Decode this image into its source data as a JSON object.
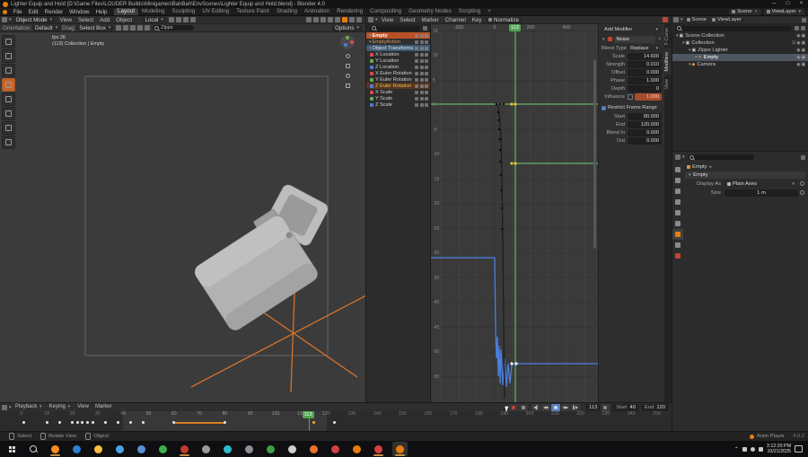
{
  "colors": {
    "accent": "#e87d0d",
    "playhead": "#53a553",
    "hold_bar": "#d87c20",
    "curve_blue": "#4a7fe0",
    "curve_green": "#69b36a"
  },
  "titlebar": {
    "title": "Lighter Equip and Hold [D:\\Game Files\\LOUDER Builds\\Minigames\\BahBah\\EnvScenes\\Lighter Equip and Hold.blend] - Blender 4.0",
    "controls": [
      "minimize",
      "maximize",
      "close"
    ]
  },
  "topbar": {
    "menus": [
      "File",
      "Edit",
      "Render",
      "Window",
      "Help"
    ],
    "tabs": [
      "Layout",
      "Modeling",
      "Sculpting",
      "UV Editing",
      "Texture Paint",
      "Shading",
      "Animation",
      "Rendering",
      "Compositing",
      "Geometry Nodes",
      "Scripting",
      "+"
    ],
    "active_tab": "Layout",
    "scene": "Scene",
    "view_layer": "ViewLayer"
  },
  "viewport": {
    "mode": "Object Mode",
    "menus": [
      "View",
      "Select",
      "Add",
      "Object"
    ],
    "transform_pivot": "Local",
    "header_icons": [
      "visibility-dropdown-icon",
      "gizmo-toggle-icon",
      "overlays-toggle-icon",
      "xray-toggle-icon",
      "wireframe-shading-icon",
      "solid-shading-icon",
      "material-shading-icon",
      "rendered-shading-icon"
    ],
    "active_shading_index": 5,
    "mid_icons": [
      "snap-magnet-icon",
      "snap-target-icon",
      "proportional-edit-icon",
      "proportional-falloff-icon"
    ],
    "tool_settings": {
      "orientation_label": "Orientation:",
      "orientation": "Default",
      "drag_label": "Drag:",
      "drag": "Select Box",
      "icons": [
        "mode-new-icon",
        "mode-add-icon",
        "mode-subtract-icon",
        "mirror-icon",
        "snap-toggle-icon"
      ],
      "search_value": "Zippo",
      "options_label": "Options"
    },
    "overlay_fps": "fps 26",
    "overlay_info": "(113) Collection | Empty",
    "tools": [
      "select-box-tool",
      "cursor-tool",
      "move-tool",
      "rotate-tool",
      "scale-tool",
      "transform-tool",
      "annotate-tool",
      "measure-tool"
    ],
    "active_tool_index": 3
  },
  "graph_editor": {
    "menus": [
      "View",
      "Select",
      "Marker",
      "Channel",
      "Key"
    ],
    "normalize_label": "Normalize",
    "frame_badge": "113",
    "channels": [
      {
        "name": "Empty",
        "kind": "object"
      },
      {
        "name": "EmptyAction",
        "kind": "action"
      },
      {
        "name": "Object Transforms",
        "kind": "group"
      },
      {
        "name": "X Location",
        "color": "#d94c4c"
      },
      {
        "name": "Y Location",
        "color": "#65b04d"
      },
      {
        "name": "Z Location",
        "color": "#4d7dd6"
      },
      {
        "name": "X Euler Rotation",
        "color": "#d94c4c"
      },
      {
        "name": "Y Euler Rotation",
        "color": "#65b04d"
      },
      {
        "name": "Z Euler Rotation",
        "color": "#4d7dd6",
        "active": true
      },
      {
        "name": "X Scale",
        "color": "#d94c4c"
      },
      {
        "name": "Y Scale",
        "color": "#65b04d"
      },
      {
        "name": "Z Scale",
        "color": "#4d7dd6"
      }
    ],
    "channel_row_icons": [
      "modifier-icon",
      "mute-icon",
      "lock-icon"
    ],
    "ruler_ticks": [
      {
        "label": "-200",
        "x": 31
      },
      {
        "label": "0",
        "x": 71
      },
      {
        "label": "200",
        "x": 111
      },
      {
        "label": "400",
        "x": 151
      }
    ],
    "y_ticks": [
      15,
      10,
      5,
      0,
      -5,
      -10,
      -15,
      -20,
      -25,
      -30,
      -35,
      -40,
      -45,
      -50,
      -55
    ],
    "playhead_x": 94,
    "curves": [
      {
        "name": "y-euler-rotation-curve",
        "color": "#69b36a",
        "points": [
          [
            0,
            89
          ],
          [
            186,
            89
          ]
        ]
      },
      {
        "name": "x-euler-rotation-curve",
        "color": "#69b36a",
        "points": [
          [
            92,
            155
          ],
          [
            186,
            155
          ]
        ]
      },
      {
        "name": "z-euler-rotation-curve",
        "color": "#4a7fe0",
        "points": [
          [
            0,
            260
          ],
          [
            71,
            260
          ],
          [
            72,
            342
          ],
          [
            73,
            372
          ],
          [
            74,
            348
          ],
          [
            75,
            392
          ],
          [
            76,
            358
          ],
          [
            77,
            400
          ],
          [
            78,
            362
          ],
          [
            80,
            402
          ],
          [
            82,
            372
          ],
          [
            84,
            404
          ],
          [
            86,
            378
          ],
          [
            88,
            400
          ],
          [
            90,
            380
          ],
          [
            93,
            378
          ],
          [
            186,
            378
          ]
        ]
      },
      {
        "name": "z-location-curve",
        "color": "#1d1d1d",
        "points": [
          [
            74,
            89
          ],
          [
            76,
            98
          ],
          [
            77,
            110
          ],
          [
            78,
            126
          ],
          [
            78.5,
            145
          ],
          [
            79,
            170
          ],
          [
            79.5,
            200
          ],
          [
            80,
            240
          ],
          [
            80.5,
            285
          ],
          [
            81,
            330
          ],
          [
            81.5,
            375
          ],
          [
            82,
            417
          ]
        ]
      }
    ],
    "key_dots_black": [
      [
        75,
        98
      ],
      [
        75.5,
        107
      ],
      [
        76,
        117
      ],
      [
        76.5,
        128
      ],
      [
        77,
        140
      ],
      [
        77.5,
        153
      ],
      [
        78,
        168
      ],
      [
        78.5,
        185
      ],
      [
        79,
        205
      ],
      [
        79.5,
        228
      ],
      [
        73,
        89
      ],
      [
        77,
        89
      ],
      [
        81,
        89
      ]
    ],
    "key_dots_yellow": [
      [
        90,
        89
      ],
      [
        94,
        89
      ],
      [
        90,
        155
      ],
      [
        94,
        155
      ]
    ],
    "key_dots_white": [
      [
        90,
        378
      ],
      [
        95,
        378
      ]
    ],
    "sidebar": {
      "add_modifier": "Add Modifier",
      "modifier_name": "Noise",
      "rows": [
        {
          "label": "Blend Type",
          "value": "Replace",
          "dropdown": true
        },
        {
          "label": "Scale",
          "value": "14.600"
        },
        {
          "label": "Strength",
          "value": "0.010"
        },
        {
          "label": "Offset",
          "value": "0.000"
        },
        {
          "label": "Phase",
          "value": "1.000"
        },
        {
          "label": "Depth",
          "value": "0"
        }
      ],
      "influence_label": "Influence",
      "influence_value": "1.000",
      "restrict_label": "Restrict Frame Range",
      "range_rows": [
        {
          "label": "Start",
          "value": "80.000"
        },
        {
          "label": "End",
          "value": "120.000"
        },
        {
          "label": "Blend In",
          "value": "0.000"
        },
        {
          "label": "Out",
          "value": "0.000"
        }
      ],
      "tabs": [
        "F-Curve",
        "Modifiers",
        "View"
      ],
      "active_tab": "Modifiers"
    }
  },
  "outliner": {
    "scene": "Scene",
    "view_layer": "ViewLayer",
    "rows": [
      {
        "label": "Scene Collection",
        "icon": "scene-collection-icon",
        "indent": 0
      },
      {
        "label": "Collection",
        "icon": "collection-icon",
        "indent": 1,
        "checkbox": true
      },
      {
        "label": "Zippo Lighter",
        "icon": "collection-icon",
        "indent": 2
      },
      {
        "label": "Empty",
        "icon": "empty-icon",
        "indent": 3,
        "selected": true
      },
      {
        "label": "Camera",
        "icon": "camera-icon",
        "indent": 2
      }
    ],
    "row_icons": [
      "hide-eye-icon",
      "disable-render-camera-icon"
    ]
  },
  "properties": {
    "tabs": [
      "tool-tab-icon",
      "render-tab-icon",
      "output-tab-icon",
      "view-layer-tab-icon",
      "scene-tab-icon",
      "world-tab-icon",
      "object-tab-icon",
      "constraints-tab-icon",
      "physics-tab-icon"
    ],
    "active_tab_index": 6,
    "breadcrumb": "Empty",
    "panel_title": "Empty",
    "display_as_label": "Display As",
    "display_as_value": "Plain Axes",
    "size_label": "Size",
    "size_value": "1 m"
  },
  "timeline": {
    "menus": [
      "Playback",
      "Keying",
      "View",
      "Marker"
    ],
    "transport": [
      "jump-to-start-button",
      "previous-keyframe-button",
      "pause-button",
      "next-keyframe-button",
      "jump-to-end-button"
    ],
    "transport_glyphs": [
      "◀▌",
      "◀◆",
      "▮▮",
      "◆▶",
      "▌▶"
    ],
    "active_transport_index": 2,
    "frame": "113",
    "start_label": "Start",
    "start": "40",
    "end_label": "End",
    "end": "120",
    "tick_step": 10,
    "tick_max": 250,
    "keyframes": [
      1,
      10,
      15,
      20,
      22,
      24,
      26,
      28,
      33,
      38,
      43,
      48,
      60,
      80,
      115,
      123
    ],
    "selected_keyframes": [
      115
    ],
    "hold_bar": [
      60,
      80
    ],
    "range": [
      40,
      120
    ],
    "current": 113
  },
  "statusbar": {
    "items": [
      "Select",
      "Rotate View",
      "Object"
    ],
    "right_label": "Anim Player",
    "version": "4.0.2"
  },
  "taskbar": {
    "apps": [
      {
        "name": "firefox",
        "color": "#ff8c1a",
        "running": true
      },
      {
        "name": "edge-browser",
        "color": "#2f7fd6"
      },
      {
        "name": "file-explorer",
        "color": "#f6c23e"
      },
      {
        "name": "ticktick",
        "color": "#4aa3e8"
      },
      {
        "name": "photos-app",
        "color": "#5a8fd6"
      },
      {
        "name": "clock-app",
        "color": "#3fae49"
      },
      {
        "name": "obs-studio",
        "color": "#c23b33",
        "running": true
      },
      {
        "name": "sphere-app",
        "color": "#9a9a9a"
      },
      {
        "name": "phone-link",
        "color": "#2fbccc"
      },
      {
        "name": "shield-app",
        "color": "#8a8f98"
      },
      {
        "name": "green-app",
        "color": "#3f9e44"
      },
      {
        "name": "window-app",
        "color": "#cfcfcf"
      },
      {
        "name": "orange-app",
        "color": "#e8722a"
      },
      {
        "name": "red-app",
        "color": "#d23f3f"
      },
      {
        "name": "blender-launcher",
        "color": "#e87d0d"
      },
      {
        "name": "red-blue-app",
        "color": "#d84040",
        "running": true
      },
      {
        "name": "blender",
        "color": "#e87d0d",
        "running": true,
        "active": true
      }
    ],
    "tray_icons": [
      "tray-chevron-icon",
      "microphone-icon",
      "network-icon",
      "volume-icon"
    ],
    "time": "3:12:20 PM",
    "date": "10/21/2025"
  }
}
